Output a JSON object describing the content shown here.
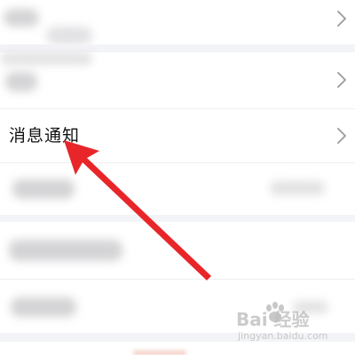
{
  "settings": {
    "notification_row": {
      "label": "消息通知"
    }
  },
  "icons": {
    "chevron": "chevron-right-icon",
    "annotation": "red-arrow-icon",
    "watermark": "baidu-paw-icon"
  },
  "colors": {
    "background": "#ffffff",
    "section_gap": "#f3f4f7",
    "chevron": "#9a9a9a",
    "arrow": "#e8262a",
    "text": "#111111"
  },
  "watermark": {
    "brand": "Bai  经验",
    "url": "jingyan.baidu.com"
  }
}
